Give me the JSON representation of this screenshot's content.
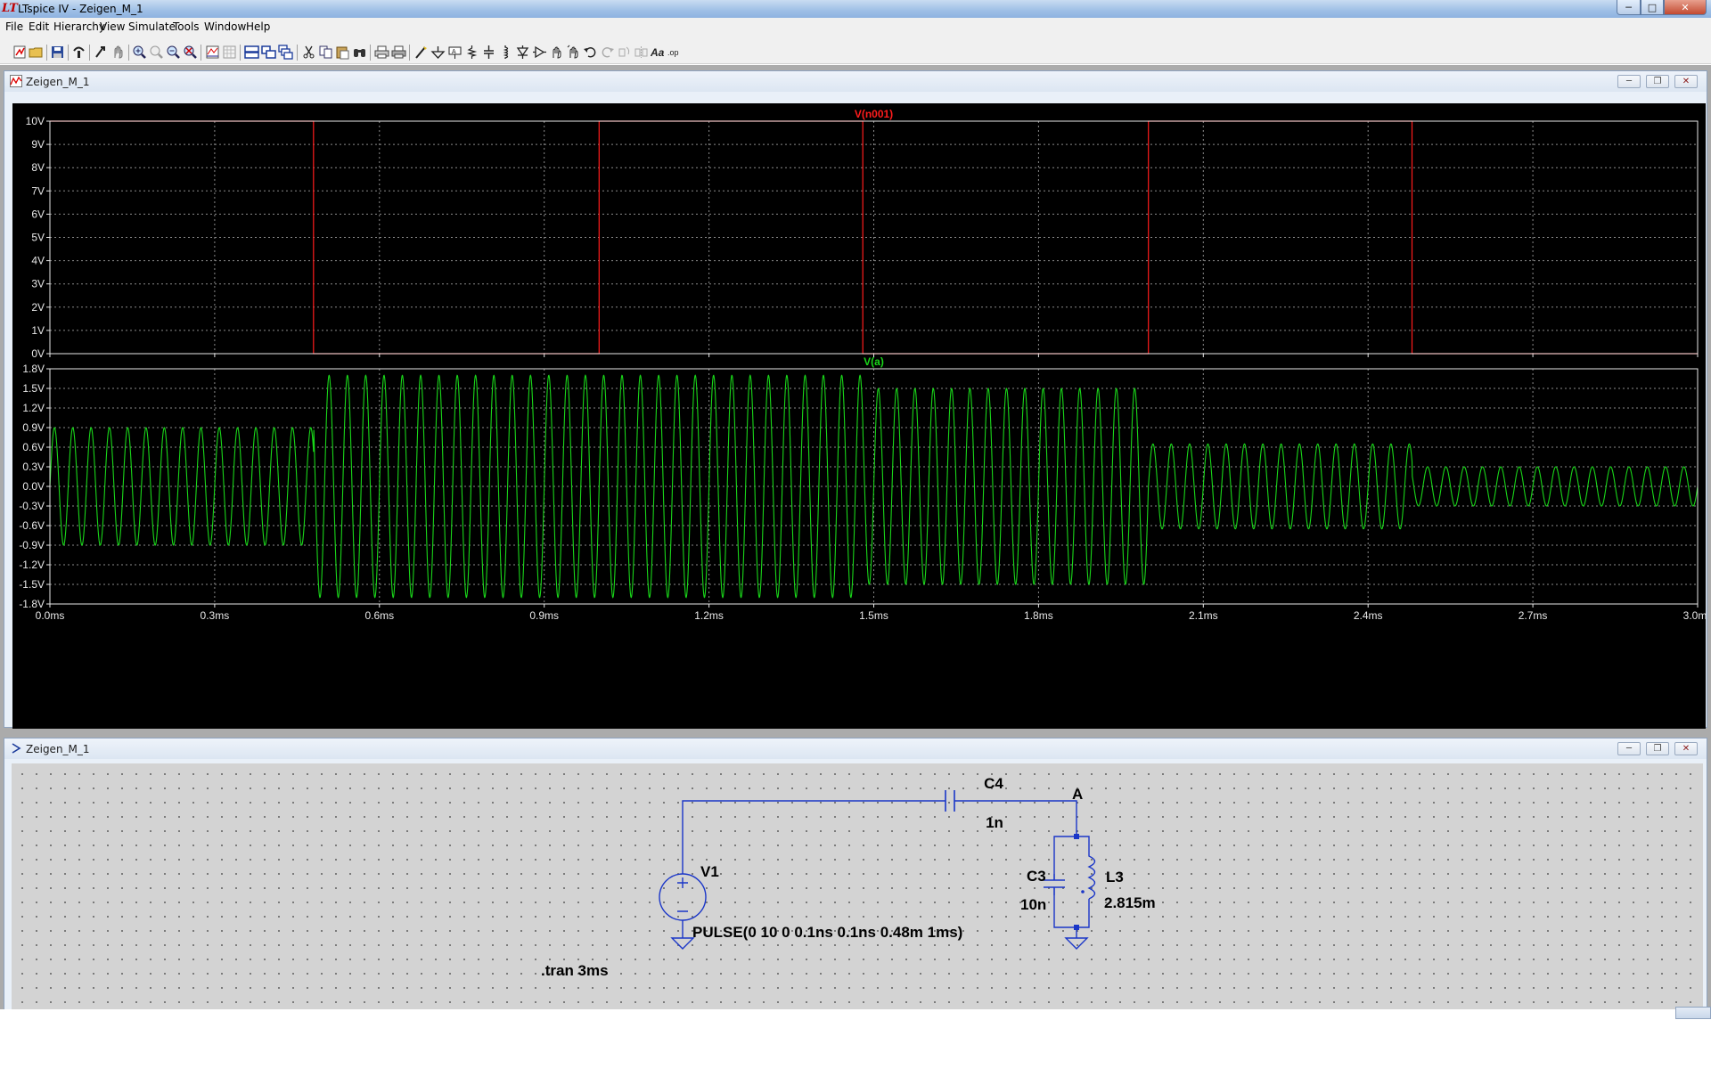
{
  "app": {
    "title": "LTspice IV - Zeigen_M_1",
    "icon": "ltspice-icon",
    "window_buttons": {
      "minimize": "─",
      "maximize": "□",
      "close": "✕"
    }
  },
  "menu": [
    "File",
    "Edit",
    "Hierarchy",
    "View",
    "Simulate",
    "Tools",
    "Window",
    "Help"
  ],
  "toolbar": [
    "new-schematic-icon",
    "open-folder-icon",
    "save-icon",
    "control-panel-icon",
    "run-icon",
    "halt-icon",
    "zoom-in-icon",
    "pan-icon",
    "zoom-out-icon",
    "zoom-fit-icon",
    "autorange-icon",
    "grid-icon",
    "tile-horizontal-icon",
    "tile-vertical-icon",
    "cascade-icon",
    "cut-icon",
    "copy-icon",
    "paste-icon",
    "find-icon",
    "print-icon",
    "print-setup-icon",
    "wire-icon",
    "ground-icon",
    "label-net-icon",
    "resistor-icon",
    "capacitor-icon",
    "inductor-icon",
    "diode-icon",
    "component-icon",
    "move-icon",
    "drag-icon",
    "undo-icon",
    "redo-icon",
    "rotate-icon",
    "mirror-icon",
    "text-icon",
    "spice-directive-icon"
  ],
  "colors": {
    "trace_top": "#ff1c1c",
    "trace_bottom": "#19d619",
    "axis": "#e8e8e8",
    "wire": "#1a36c8"
  },
  "plot_window": {
    "title": "Zeigen_M_1",
    "buttons": {
      "minimize": "─",
      "restore": "❐",
      "close": "✕"
    }
  },
  "schematic_window": {
    "title": "Zeigen_M_1",
    "buttons": {
      "minimize": "─",
      "restore": "❐",
      "close": "✕"
    }
  },
  "chart_data": [
    {
      "type": "line",
      "title": "V(n001)",
      "x_unit": "ms",
      "xlim": [
        0,
        3.0
      ],
      "ylim": [
        0,
        10
      ],
      "x_ticks": [
        "0.0ms",
        "0.3ms",
        "0.6ms",
        "0.9ms",
        "1.2ms",
        "1.5ms",
        "1.8ms",
        "2.1ms",
        "2.4ms",
        "2.7ms",
        "3.0ms"
      ],
      "y_ticks": [
        "0V",
        "1V",
        "2V",
        "3V",
        "4V",
        "5V",
        "6V",
        "7V",
        "8V",
        "9V",
        "10V"
      ],
      "grid": true,
      "series": [
        {
          "color": "#ff1c1c",
          "x": [
            0,
            0.48,
            0.48,
            1.0,
            1.0,
            1.48,
            1.48,
            2.0,
            2.0,
            2.48,
            2.48,
            3.0
          ],
          "y": [
            10,
            10,
            0,
            0,
            10,
            10,
            0,
            0,
            10,
            10,
            0,
            0
          ]
        }
      ]
    },
    {
      "type": "line",
      "title": "V(a)",
      "x_unit": "ms",
      "xlim": [
        0,
        3.0
      ],
      "ylim": [
        -1.8,
        1.8
      ],
      "x_ticks": [
        "0.0ms",
        "0.3ms",
        "0.6ms",
        "0.9ms",
        "1.2ms",
        "1.5ms",
        "1.8ms",
        "2.1ms",
        "2.4ms",
        "2.7ms",
        "3.0ms"
      ],
      "y_ticks": [
        "1.8V",
        "1.5V",
        "1.2V",
        "0.9V",
        "0.6V",
        "0.3V",
        "0.0V",
        "-0.3V",
        "-0.6V",
        "-0.9V",
        "-1.2V",
        "-1.5V",
        "-1.8V"
      ],
      "grid": true,
      "series": [
        {
          "color": "#19d619",
          "frequency_khz": 30,
          "segments": [
            {
              "x0": 0,
              "x1": 0.48,
              "amplitude": 0.9
            },
            {
              "x0": 0.48,
              "x1": 1.48,
              "amplitude": 1.7
            },
            {
              "x0": 1.48,
              "x1": 2.0,
              "amplitude": 1.5
            },
            {
              "x0": 2.0,
              "x1": 2.48,
              "amplitude": 0.65
            },
            {
              "x0": 2.48,
              "x1": 3.0,
              "amplitude": 0.3
            }
          ]
        }
      ]
    }
  ],
  "schematic": {
    "components": {
      "C4": {
        "name": "C4",
        "value": "1n"
      },
      "V1": {
        "name": "V1",
        "value": "PULSE(0 10 0 0.1ns 0.1ns 0.48m 1ms)"
      },
      "C3": {
        "name": "C3",
        "value": "10n"
      },
      "L3": {
        "name": "L3",
        "value": "2.815m"
      }
    },
    "net_label": "A",
    "directive": ".tran 3ms"
  }
}
